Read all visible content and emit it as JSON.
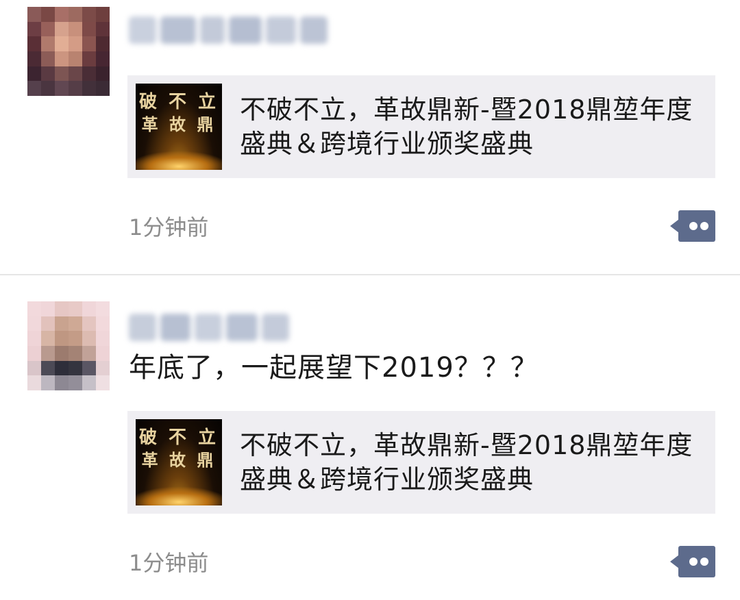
{
  "posts": [
    {
      "author_blurred": true,
      "text": "",
      "link": {
        "title": "不破不立，革故鼎新-暨2018鼎堃年度盛典＆跨境行业颁奖盛典",
        "thumb_line1": "破 不 立",
        "thumb_line2": "革 故 鼎"
      },
      "time": "1分钟前",
      "comment_icon": "comment-dots-icon"
    },
    {
      "author_blurred": true,
      "text": "年底了，一起展望下2019？？？",
      "link": {
        "title": "不破不立，革故鼎新-暨2018鼎堃年度盛典＆跨境行业颁奖盛典",
        "thumb_line1": "破 不 立",
        "thumb_line2": "革 故 鼎"
      },
      "time": "1分钟前",
      "comment_icon": "comment-dots-icon"
    }
  ],
  "colors": {
    "comment_button": "#5d6b8c",
    "card_bg": "#efeef2",
    "timestamp": "#8c8c8c"
  }
}
